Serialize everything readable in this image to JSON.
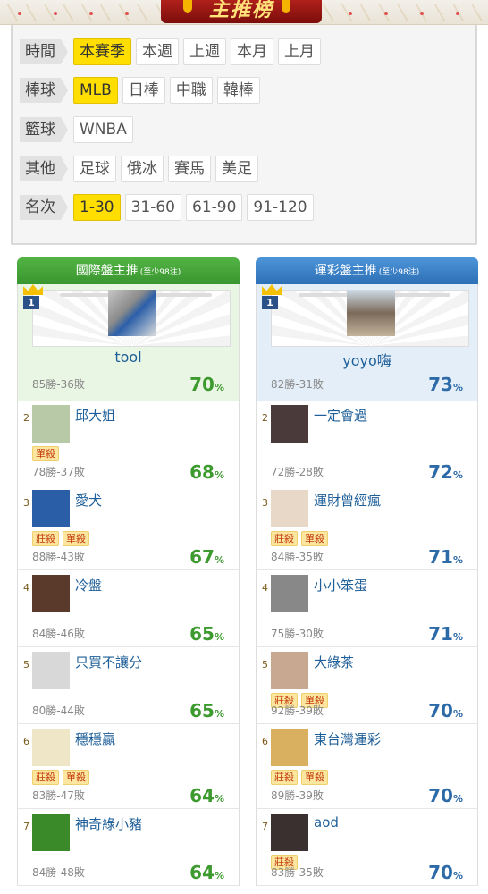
{
  "banner": {
    "title": "主推榜"
  },
  "filters": [
    {
      "label": "時間",
      "options": [
        "本賽季",
        "本週",
        "上週",
        "本月",
        "上月"
      ],
      "selected": 0
    },
    {
      "label": "棒球",
      "options": [
        "MLB",
        "日棒",
        "中職",
        "韓棒"
      ],
      "selected": 0
    },
    {
      "label": "籃球",
      "options": [
        "WNBA"
      ],
      "selected": -1
    },
    {
      "label": "其他",
      "options": [
        "足球",
        "俄冰",
        "賽馬",
        "美足"
      ],
      "selected": -1
    },
    {
      "label": "名次",
      "options": [
        "1-30",
        "31-60",
        "61-90",
        "91-120"
      ],
      "selected": 0
    }
  ],
  "left": {
    "title": "國際盤主推",
    "note": "(至少98注)",
    "top": {
      "rank": "1",
      "name": "tool",
      "record": "85勝-36敗",
      "pct": "70",
      "unit": "%"
    },
    "items": [
      {
        "rank": "2",
        "name": "邱大姐",
        "badges": [
          "單殺"
        ],
        "record": "78勝-37敗",
        "pct": "68",
        "unit": "%",
        "thumb_color": "#b8c9a8"
      },
      {
        "rank": "3",
        "name": "愛犬",
        "badges": [
          "莊殺",
          "單殺"
        ],
        "record": "88勝-43敗",
        "pct": "67",
        "unit": "%",
        "thumb_color": "#2a5fa8"
      },
      {
        "rank": "4",
        "name": "冷盤",
        "badges": [],
        "record": "84勝-46敗",
        "pct": "65",
        "unit": "%",
        "thumb_color": "#5a3a2a"
      },
      {
        "rank": "5",
        "name": "只買不讓分",
        "badges": [],
        "record": "80勝-44敗",
        "pct": "65",
        "unit": "%",
        "thumb_color": "#d8d8d8"
      },
      {
        "rank": "6",
        "name": "穩穩贏",
        "badges": [
          "莊殺",
          "單殺"
        ],
        "record": "83勝-47敗",
        "pct": "64",
        "unit": "%",
        "thumb_color": "#efe6c8"
      },
      {
        "rank": "7",
        "name": "神奇綠小豬",
        "badges": [],
        "record": "84勝-48敗",
        "pct": "64",
        "unit": "%",
        "thumb_color": "#3a8a2a"
      }
    ]
  },
  "right": {
    "title": "運彩盤主推",
    "note": "(至少98注)",
    "top": {
      "rank": "1",
      "name": "yoyo嗨",
      "record": "82勝-31敗",
      "pct": "73",
      "unit": "%"
    },
    "items": [
      {
        "rank": "2",
        "name": "一定會過",
        "badges": [],
        "record": "72勝-28敗",
        "pct": "72",
        "unit": "%",
        "thumb_color": "#4a3a3a"
      },
      {
        "rank": "3",
        "name": "運財曾經瘋",
        "badges": [
          "莊殺",
          "單殺"
        ],
        "record": "84勝-35敗",
        "pct": "71",
        "unit": "%",
        "thumb_color": "#e8d8c8"
      },
      {
        "rank": "4",
        "name": "小小笨蛋",
        "badges": [],
        "record": "75勝-30敗",
        "pct": "71",
        "unit": "%",
        "thumb_color": "#888888"
      },
      {
        "rank": "5",
        "name": "大綠茶",
        "badges": [
          "莊殺",
          "單殺"
        ],
        "record": "92勝-39敗",
        "pct": "70",
        "unit": "%",
        "thumb_color": "#c8a890"
      },
      {
        "rank": "6",
        "name": "東台灣運彩",
        "badges": [
          "莊殺",
          "單殺"
        ],
        "record": "89勝-39敗",
        "pct": "70",
        "unit": "%",
        "thumb_color": "#d8b060"
      },
      {
        "rank": "7",
        "name": "aod",
        "badges": [
          "莊殺"
        ],
        "record": "83勝-35敗",
        "pct": "70",
        "unit": "%",
        "thumb_color": "#3a3030"
      }
    ]
  }
}
